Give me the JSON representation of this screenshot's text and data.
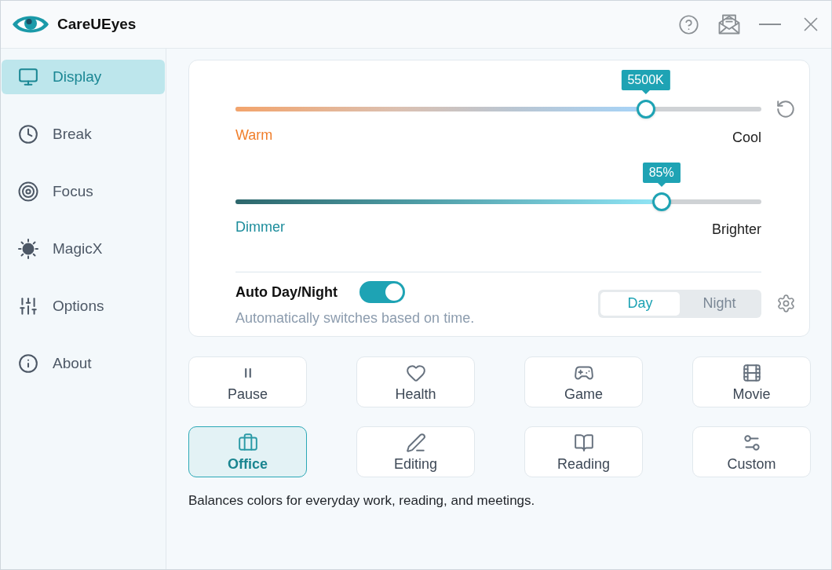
{
  "window": {
    "title": "CareUEyes"
  },
  "sidebar": {
    "items": [
      {
        "label": "Display",
        "selected": true
      },
      {
        "label": "Break",
        "selected": false
      },
      {
        "label": "Focus",
        "selected": false
      },
      {
        "label": "MagicX",
        "selected": false
      },
      {
        "label": "Options",
        "selected": false
      },
      {
        "label": "About",
        "selected": false
      }
    ]
  },
  "sliders": [
    {
      "kind": "temperature",
      "value_label": "5500K",
      "level": 0.78,
      "min_label": "Warm",
      "max_label": "Cool"
    },
    {
      "kind": "brightness",
      "value_label": "85%",
      "level": 0.81,
      "min_label": "Dimmer",
      "max_label": "Brighter"
    }
  ],
  "auto_day_night": {
    "label": "Auto Day/Night",
    "on": true,
    "description": "Automatically switches based on time.",
    "modes": [
      {
        "label": "Day",
        "selected": true
      },
      {
        "label": "Night",
        "selected": false
      }
    ]
  },
  "presets": [
    {
      "label": "Pause",
      "selected": false
    },
    {
      "label": "Health",
      "selected": false
    },
    {
      "label": "Game",
      "selected": false
    },
    {
      "label": "Movie",
      "selected": false
    },
    {
      "label": "Office",
      "selected": true
    },
    {
      "label": "Editing",
      "selected": false
    },
    {
      "label": "Reading",
      "selected": false
    },
    {
      "label": "Custom",
      "selected": false
    }
  ],
  "preset_description": "Balances colors for everyday work, reading, and meetings."
}
